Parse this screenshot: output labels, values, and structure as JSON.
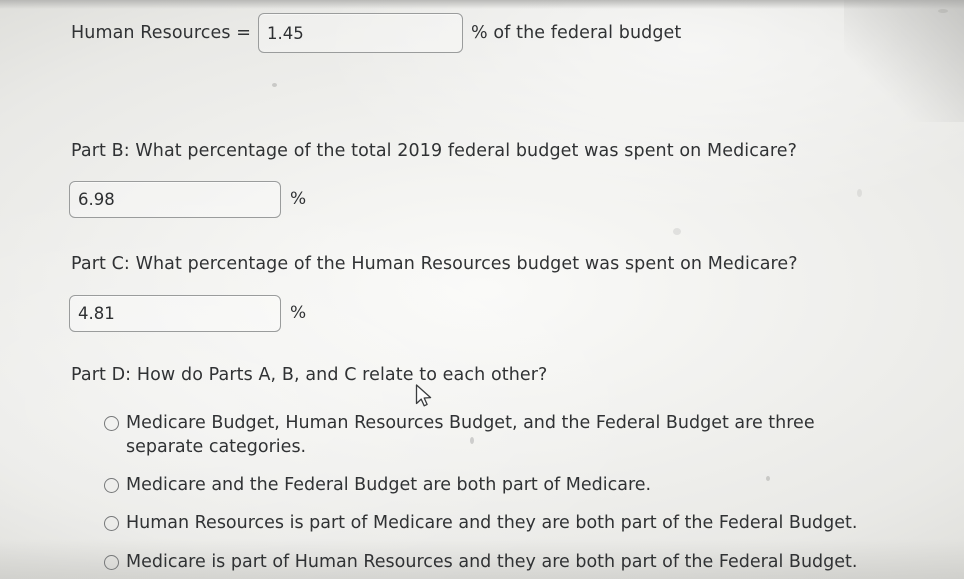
{
  "part_a": {
    "label": "Human Resources =",
    "answer_value": "1.45",
    "unit_suffix": "% of the federal budget",
    "placeholder": ""
  },
  "part_b": {
    "question": "Part B: What percentage of the total 2019 federal budget was spent on Medicare?",
    "answer_value": "6.98",
    "unit": "%",
    "placeholder": ""
  },
  "part_c": {
    "question": "Part C: What percentage of the Human Resources budget was spent on Medicare?",
    "answer_value": "4.81",
    "unit": "%",
    "placeholder": ""
  },
  "part_d": {
    "question": "Part D: How do Parts A, B, and C relate to each other?",
    "options": [
      {
        "label": "Medicare Budget, Human Resources Budget, and the Federal Budget are three separate categories.",
        "selected": false
      },
      {
        "label": "Medicare and the Federal Budget are both part of Medicare.",
        "selected": false
      },
      {
        "label": "Human Resources is part of Medicare and they are both part of the Federal Budget.",
        "selected": false
      },
      {
        "label": "Medicare is part of Human Resources and they are both part of the Federal Budget.",
        "selected": false
      }
    ]
  },
  "colors": {
    "background": "#e9e9e7",
    "text": "#303234",
    "input_border": "#9a9c9c",
    "radio_border": "#77797a"
  }
}
